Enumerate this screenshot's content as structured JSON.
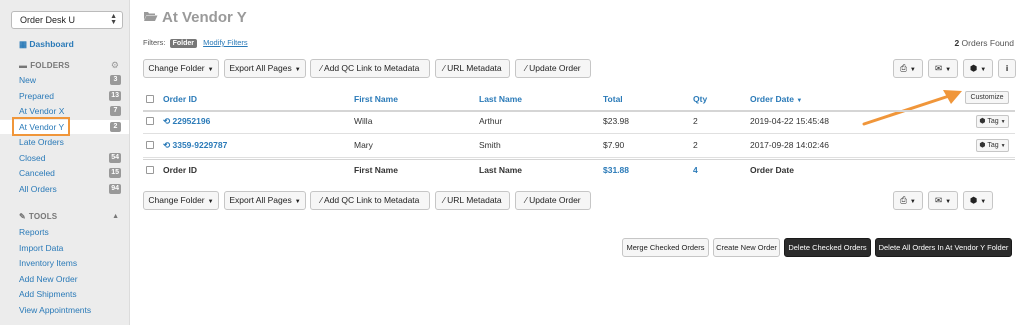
{
  "sidebar": {
    "store_select": "Order Desk U",
    "dashboard_label": "Dashboard",
    "folders_header": "FOLDERS",
    "folders": [
      {
        "label": "New",
        "count": "3"
      },
      {
        "label": "Prepared",
        "count": "13"
      },
      {
        "label": "At Vendor X",
        "count": "7"
      },
      {
        "label": "At Vendor Y",
        "count": "2"
      },
      {
        "label": "Late Orders",
        "count": ""
      },
      {
        "label": "Closed",
        "count": "54"
      },
      {
        "label": "Canceled",
        "count": "15"
      },
      {
        "label": "All Orders",
        "count": "94"
      }
    ],
    "tools_header": "TOOLS",
    "tools": [
      {
        "label": "Reports"
      },
      {
        "label": "Import Data"
      },
      {
        "label": "Inventory Items"
      },
      {
        "label": "Add New Order"
      },
      {
        "label": "Add Shipments"
      },
      {
        "label": "View Appointments"
      }
    ]
  },
  "main": {
    "title": "At Vendor Y",
    "filters_label": "Filters:",
    "filter_tag": "Folder",
    "modify_filters": "Modify Filters",
    "orders_found_count": "2",
    "orders_found_text": "Orders Found",
    "toolbar": {
      "change_folder": "Change Folder",
      "export_all": "Export All Pages",
      "add_qc": "Add QC Link to Metadata",
      "url_metadata": "URL Metadata",
      "update_order": "Update Order"
    },
    "customize_label": "Customize",
    "table": {
      "headers": [
        "Order ID",
        "First Name",
        "Last Name",
        "Total",
        "Qty",
        "Order Date"
      ],
      "rows": [
        {
          "order_id": "22952196",
          "first": "Willa",
          "last": "Arthur",
          "total": "$23.98",
          "qty": "2",
          "date": "2019-04-22 15:45:48",
          "tag": "Tag"
        },
        {
          "order_id": "3359-9229787",
          "first": "Mary",
          "last": "Smith",
          "total": "$7.90",
          "qty": "2",
          "date": "2017-09-28 14:02:46",
          "tag": "Tag"
        }
      ],
      "footer": {
        "order_id": "Order ID",
        "first": "First Name",
        "last": "Last Name",
        "total": "$31.88",
        "qty": "4",
        "date": "Order Date"
      }
    },
    "bottom_actions": {
      "merge": "Merge Checked Orders",
      "create": "Create New Order",
      "delete_checked": "Delete Checked Orders",
      "delete_all": "Delete All Orders In At Vendor Y Folder"
    }
  },
  "colors": {
    "link": "#2a7ab8",
    "highlight": "#f0963a",
    "sidebar_bg": "#ececec"
  }
}
